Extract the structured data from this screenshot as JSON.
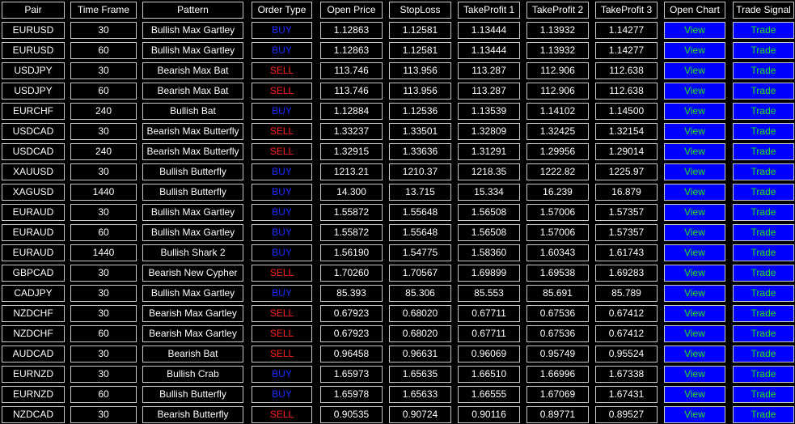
{
  "headers": [
    "Pair",
    "Time Frame",
    "Pattern",
    "Order Type",
    "Open Price",
    "StopLoss",
    "TakeProfit 1",
    "TakeProfit 2",
    "TakeProfit 3",
    "Open Chart",
    "Trade Signal"
  ],
  "view_label": "View",
  "trade_label": "Trade",
  "colors": {
    "background": "#000000",
    "cell_border": "#c8c8c8",
    "text": "#ffffff",
    "buy": "#1a2cff",
    "sell": "#ff2020",
    "button_bg": "#0000ff",
    "button_text": "#20e020"
  },
  "rows": [
    {
      "pair": "EURUSD",
      "tf": "30",
      "pattern": "Bullish Max Gartley",
      "type": "BUY",
      "open": "1.12863",
      "sl": "1.12581",
      "tp1": "1.13444",
      "tp2": "1.13932",
      "tp3": "1.14277"
    },
    {
      "pair": "EURUSD",
      "tf": "60",
      "pattern": "Bullish Max Gartley",
      "type": "BUY",
      "open": "1.12863",
      "sl": "1.12581",
      "tp1": "1.13444",
      "tp2": "1.13932",
      "tp3": "1.14277"
    },
    {
      "pair": "USDJPY",
      "tf": "30",
      "pattern": "Bearish Max Bat",
      "type": "SELL",
      "open": "113.746",
      "sl": "113.956",
      "tp1": "113.287",
      "tp2": "112.906",
      "tp3": "112.638"
    },
    {
      "pair": "USDJPY",
      "tf": "60",
      "pattern": "Bearish Max Bat",
      "type": "SELL",
      "open": "113.746",
      "sl": "113.956",
      "tp1": "113.287",
      "tp2": "112.906",
      "tp3": "112.638"
    },
    {
      "pair": "EURCHF",
      "tf": "240",
      "pattern": "Bullish Bat",
      "type": "BUY",
      "open": "1.12884",
      "sl": "1.12536",
      "tp1": "1.13539",
      "tp2": "1.14102",
      "tp3": "1.14500"
    },
    {
      "pair": "USDCAD",
      "tf": "30",
      "pattern": "Bearish Max Butterfly",
      "type": "SELL",
      "open": "1.33237",
      "sl": "1.33501",
      "tp1": "1.32809",
      "tp2": "1.32425",
      "tp3": "1.32154"
    },
    {
      "pair": "USDCAD",
      "tf": "240",
      "pattern": "Bearish Max Butterfly",
      "type": "SELL",
      "open": "1.32915",
      "sl": "1.33636",
      "tp1": "1.31291",
      "tp2": "1.29956",
      "tp3": "1.29014"
    },
    {
      "pair": "XAUUSD",
      "tf": "30",
      "pattern": "Bullish Butterfly",
      "type": "BUY",
      "open": "1213.21",
      "sl": "1210.37",
      "tp1": "1218.35",
      "tp2": "1222.82",
      "tp3": "1225.97"
    },
    {
      "pair": "XAGUSD",
      "tf": "1440",
      "pattern": "Bullish Butterfly",
      "type": "BUY",
      "open": "14.300",
      "sl": "13.715",
      "tp1": "15.334",
      "tp2": "16.239",
      "tp3": "16.879"
    },
    {
      "pair": "EURAUD",
      "tf": "30",
      "pattern": "Bullish Max Gartley",
      "type": "BUY",
      "open": "1.55872",
      "sl": "1.55648",
      "tp1": "1.56508",
      "tp2": "1.57006",
      "tp3": "1.57357"
    },
    {
      "pair": "EURAUD",
      "tf": "60",
      "pattern": "Bullish Max Gartley",
      "type": "BUY",
      "open": "1.55872",
      "sl": "1.55648",
      "tp1": "1.56508",
      "tp2": "1.57006",
      "tp3": "1.57357"
    },
    {
      "pair": "EURAUD",
      "tf": "1440",
      "pattern": "Bullish Shark 2",
      "type": "BUY",
      "open": "1.56190",
      "sl": "1.54775",
      "tp1": "1.58360",
      "tp2": "1.60343",
      "tp3": "1.61743"
    },
    {
      "pair": "GBPCAD",
      "tf": "30",
      "pattern": "Bearish New Cypher",
      "type": "SELL",
      "open": "1.70260",
      "sl": "1.70567",
      "tp1": "1.69899",
      "tp2": "1.69538",
      "tp3": "1.69283"
    },
    {
      "pair": "CADJPY",
      "tf": "30",
      "pattern": "Bullish Max Gartley",
      "type": "BUY",
      "open": "85.393",
      "sl": "85.306",
      "tp1": "85.553",
      "tp2": "85.691",
      "tp3": "85.789"
    },
    {
      "pair": "NZDCHF",
      "tf": "30",
      "pattern": "Bearish Max Gartley",
      "type": "SELL",
      "open": "0.67923",
      "sl": "0.68020",
      "tp1": "0.67711",
      "tp2": "0.67536",
      "tp3": "0.67412"
    },
    {
      "pair": "NZDCHF",
      "tf": "60",
      "pattern": "Bearish Max Gartley",
      "type": "SELL",
      "open": "0.67923",
      "sl": "0.68020",
      "tp1": "0.67711",
      "tp2": "0.67536",
      "tp3": "0.67412"
    },
    {
      "pair": "AUDCAD",
      "tf": "30",
      "pattern": "Bearish Bat",
      "type": "SELL",
      "open": "0.96458",
      "sl": "0.96631",
      "tp1": "0.96069",
      "tp2": "0.95749",
      "tp3": "0.95524"
    },
    {
      "pair": "EURNZD",
      "tf": "30",
      "pattern": "Bullish Crab",
      "type": "BUY",
      "open": "1.65973",
      "sl": "1.65635",
      "tp1": "1.66510",
      "tp2": "1.66996",
      "tp3": "1.67338"
    },
    {
      "pair": "EURNZD",
      "tf": "60",
      "pattern": "Bullish Butterfly",
      "type": "BUY",
      "open": "1.65978",
      "sl": "1.65633",
      "tp1": "1.66555",
      "tp2": "1.67069",
      "tp3": "1.67431"
    },
    {
      "pair": "NZDCAD",
      "tf": "30",
      "pattern": "Bearish Butterfly",
      "type": "SELL",
      "open": "0.90535",
      "sl": "0.90724",
      "tp1": "0.90116",
      "tp2": "0.89771",
      "tp3": "0.89527"
    }
  ]
}
